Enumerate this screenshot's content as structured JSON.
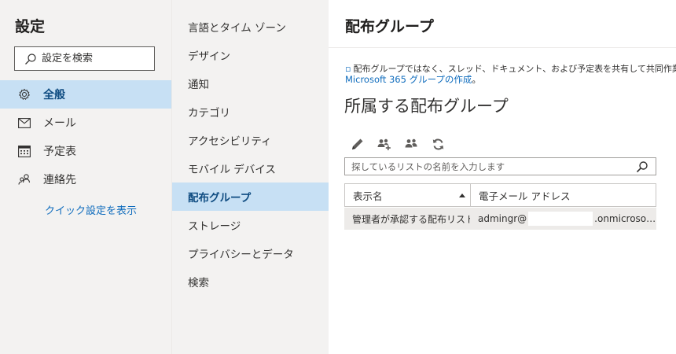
{
  "settings": {
    "title": "設定",
    "search_placeholder": "設定を検索"
  },
  "nav": {
    "items": [
      {
        "label": "全般",
        "icon": "gear-icon",
        "selected": true
      },
      {
        "label": "メール",
        "icon": "mail-icon",
        "selected": false
      },
      {
        "label": "予定表",
        "icon": "calendar-icon",
        "selected": false
      },
      {
        "label": "連絡先",
        "icon": "people-icon",
        "selected": false
      }
    ],
    "quick_settings_link": "クイック設定を表示"
  },
  "subnav": {
    "items": [
      {
        "label": "言語とタイム ゾーン",
        "selected": false
      },
      {
        "label": "デザイン",
        "selected": false
      },
      {
        "label": "通知",
        "selected": false
      },
      {
        "label": "カテゴリ",
        "selected": false
      },
      {
        "label": "アクセシビリティ",
        "selected": false
      },
      {
        "label": "モバイル デバイス",
        "selected": false
      },
      {
        "label": "配布グループ",
        "selected": true
      },
      {
        "label": "ストレージ",
        "selected": false
      },
      {
        "label": "プライバシーとデータ",
        "selected": false
      },
      {
        "label": "検索",
        "selected": false
      }
    ]
  },
  "main": {
    "page_title": "配布グループ",
    "description": "配布グループではなく、スレッド、ドキュメント、および予定表を共有して共同作業を行う、新",
    "link_text": "Microsoft 365 グループの作成",
    "link_tail": "。",
    "section_title": "所属する配布グループ",
    "toolbar": {
      "edit": "edit-icon",
      "join": "join-group-icon",
      "people": "people-group-icon",
      "refresh": "refresh-icon"
    },
    "list_search_placeholder": "探しているリストの名前を入力します",
    "table": {
      "columns": [
        "表示名",
        "電子メール アドレス"
      ],
      "rows": [
        {
          "display_name": "管理者が承認する配布リスト",
          "email_prefix": "admingr@",
          "email_suffix": ".onmicroso…"
        }
      ]
    }
  },
  "colors": {
    "selected_bg": "#c7e0f4",
    "pane_bg": "#f3f2f1",
    "link": "#0f6cbd",
    "selected_text": "#0f4c81"
  }
}
